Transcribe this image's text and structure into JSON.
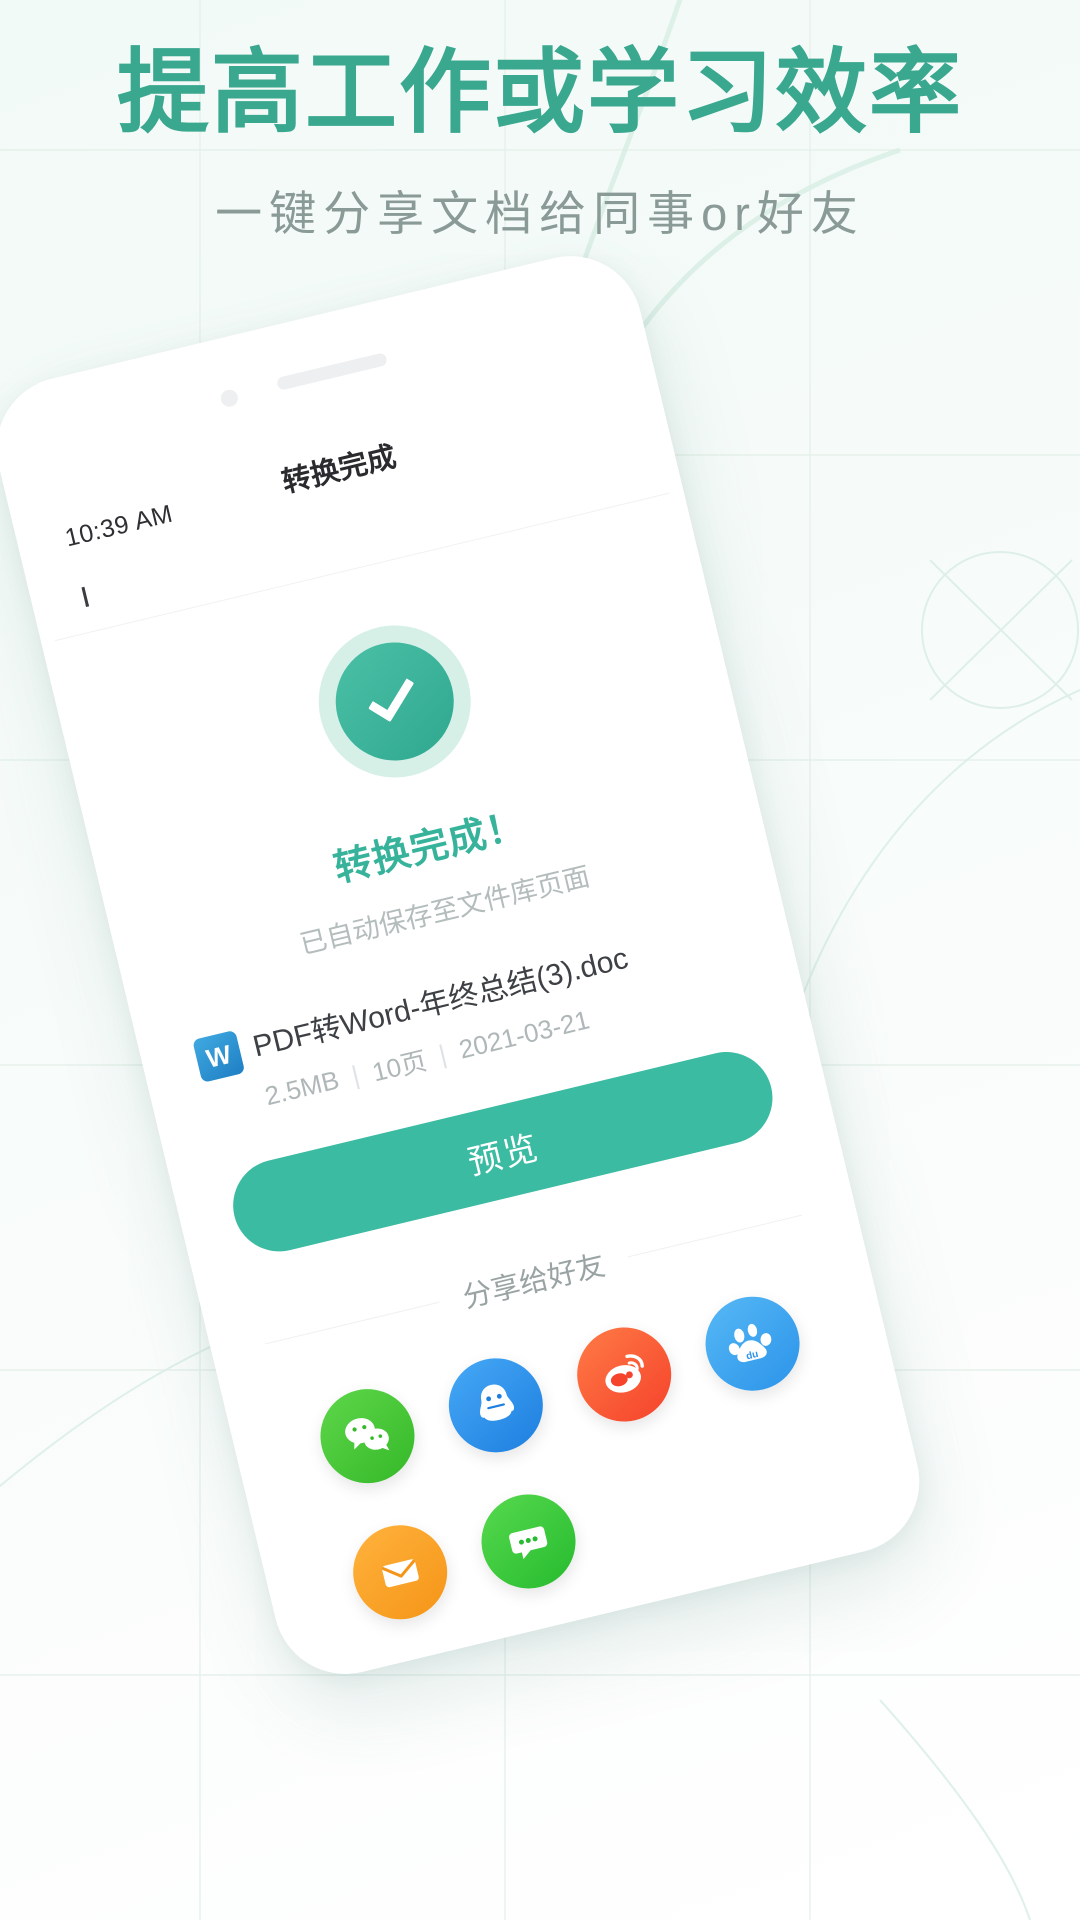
{
  "promo": {
    "headline": "提高工作或学习效率",
    "subhead": "一键分享文档给同事or好友",
    "accent_color": "#3aa78f",
    "subhead_color": "#8a9a96"
  },
  "phone": {
    "statusbar": {
      "time": "10:39 AM"
    },
    "navbar": {
      "title": "转换完成",
      "back_icon": "chevron-left-icon"
    },
    "success": {
      "icon": "check-circle-icon",
      "title": "转换完成！",
      "subtitle": "已自动保存至文件库页面",
      "title_color": "#36b39a"
    },
    "file": {
      "type_icon_label": "W",
      "type_icon_color": "#2188cc",
      "name": "PDF转Word-年终总结(3).doc",
      "size": "2.5MB",
      "pages": "10页",
      "date": "2021-03-21",
      "separator": "|"
    },
    "preview_button": {
      "label": "预览",
      "color": "#3bbba2"
    },
    "share": {
      "heading": "分享给好友",
      "targets": [
        {
          "name": "wechat",
          "icon": "wechat-icon",
          "color": "#35b929"
        },
        {
          "name": "qq",
          "icon": "qq-icon",
          "color": "#1e7fe0"
        },
        {
          "name": "weibo",
          "icon": "weibo-icon",
          "color": "#f5432c"
        },
        {
          "name": "baidu",
          "icon": "baidu-icon",
          "color": "#2c94ea"
        },
        {
          "name": "email",
          "icon": "email-icon",
          "color": "#f59518"
        },
        {
          "name": "message",
          "icon": "message-icon",
          "color": "#27bb2f"
        }
      ]
    }
  }
}
